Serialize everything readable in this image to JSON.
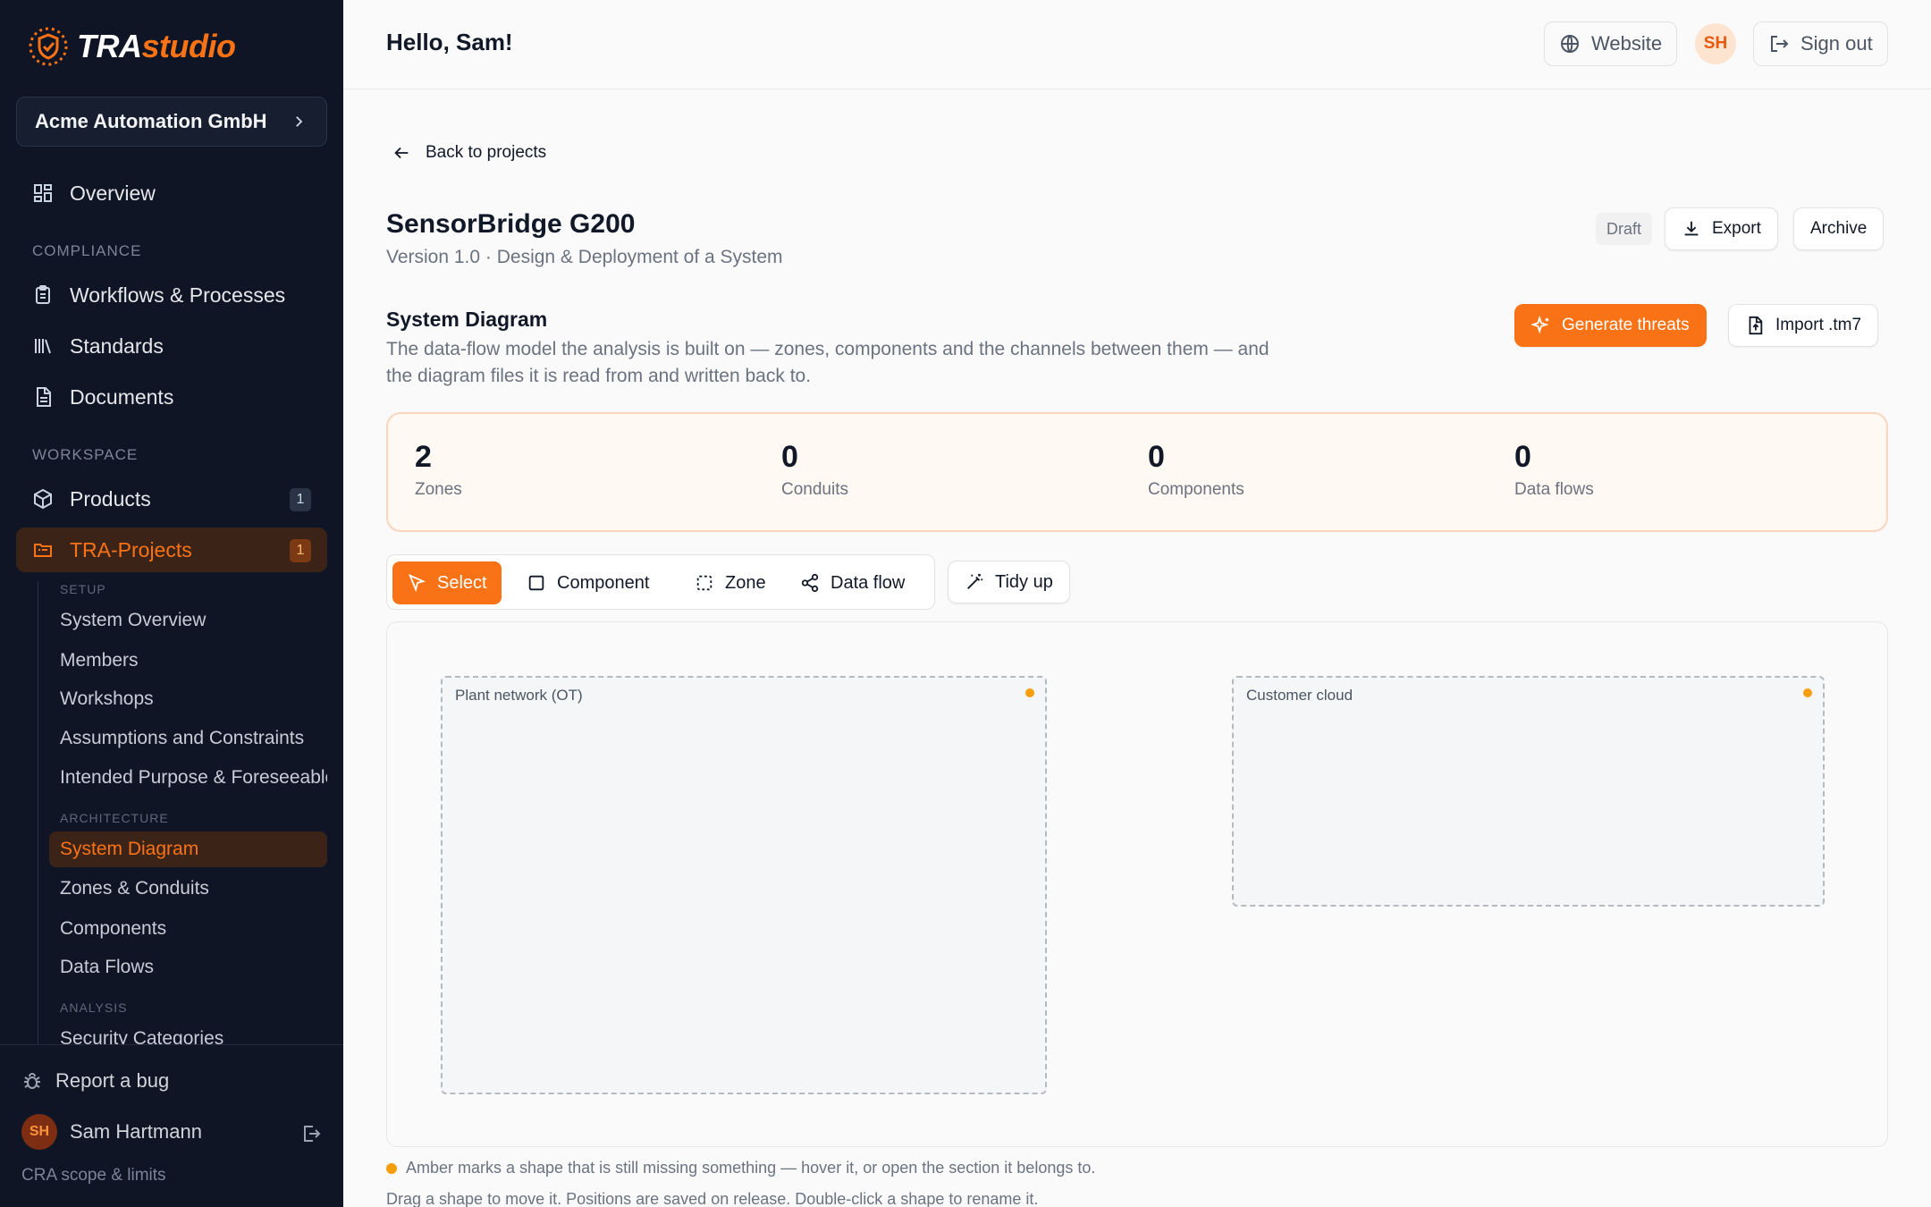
{
  "app": {
    "logo_left": "TRA",
    "logo_right": "studio",
    "org_name": "Acme Automation GmbH"
  },
  "sidebar": {
    "overview": "Overview",
    "compliance_label": "COMPLIANCE",
    "compliance_items": [
      "Workflows & Processes",
      "Standards",
      "Documents"
    ],
    "workspace_label": "WORKSPACE",
    "products": {
      "label": "Products",
      "count": "1"
    },
    "tra_projects": {
      "label": "TRA-Projects",
      "count": "1"
    },
    "setup_label": "SETUP",
    "setup_items": [
      "System Overview",
      "Members",
      "Workshops",
      "Assumptions and Constraints",
      "Intended Purpose & Foreseeable Misuse"
    ],
    "architecture_label": "ARCHITECTURE",
    "architecture_items": [
      "System Diagram",
      "Zones & Conduits",
      "Components",
      "Data Flows"
    ],
    "analysis_label": "ANALYSIS",
    "analysis_items": [
      "Security Categories"
    ],
    "footer": {
      "report_bug": "Report a bug",
      "user_initials": "SH",
      "user_name": "Sam Hartmann",
      "scope_link": "CRA scope & limits"
    }
  },
  "header": {
    "greeting": "Hello, Sam!",
    "website": "Website",
    "avatar_initials": "SH",
    "sign_out": "Sign out"
  },
  "project": {
    "back": "Back to projects",
    "title": "SensorBridge G200",
    "subtitle": "Version 1.0 · Design & Deployment of a System",
    "status": "Draft",
    "export": "Export",
    "archive": "Archive"
  },
  "diagram": {
    "heading": "System Diagram",
    "description": "The data-flow model the analysis is built on — zones, components and the channels between them — and the diagram files it is read from and written back to.",
    "generate": "Generate threats",
    "import": "Import .tm7",
    "stats": [
      {
        "value": "2",
        "label": "Zones"
      },
      {
        "value": "0",
        "label": "Conduits"
      },
      {
        "value": "0",
        "label": "Components"
      },
      {
        "value": "0",
        "label": "Data flows"
      }
    ],
    "tools": [
      "Select",
      "Component",
      "Zone",
      "Data flow"
    ],
    "tidy": "Tidy up",
    "zones": [
      "Plant network (OT)",
      "Customer cloud"
    ],
    "legend": "Amber marks a shape that is still missing something — hover it, or open the section it belongs to.",
    "hint": "Drag a shape to move it. Positions are saved on release. Double-click a shape to rename it."
  },
  "colors": {
    "accent": "#f97316",
    "sidebar_bg": "#0f1524",
    "amber": "#f59e0b"
  }
}
